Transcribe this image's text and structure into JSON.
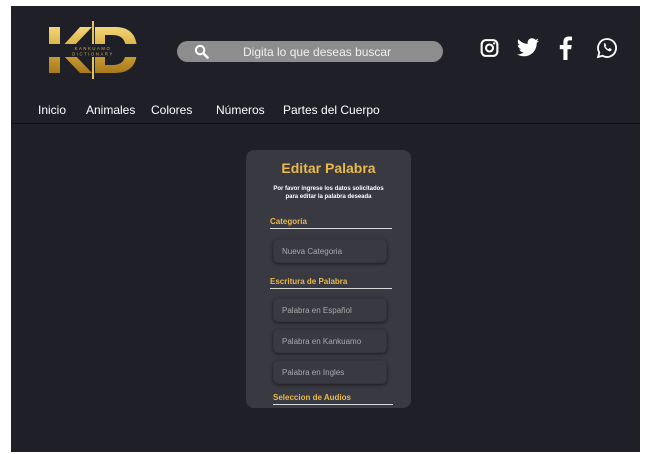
{
  "brand": {
    "logo_letters": "KD",
    "logo_line1": "KANKUAMO",
    "logo_line2": "DICTIONARY"
  },
  "search": {
    "placeholder": "Digita lo que deseas buscar"
  },
  "social": [
    "instagram-icon",
    "twitter-icon",
    "facebook-icon",
    "whatsapp-icon"
  ],
  "nav": {
    "items": [
      "Inicio",
      "Animales",
      "Colores",
      "Números",
      "Partes del Cuerpo"
    ]
  },
  "form": {
    "title": "Editar Palabra",
    "subtitle_line1": "Por favor ingrese los datos solicitados",
    "subtitle_line2": "para editar la palabra deseada",
    "section_category": "Categoria",
    "category_placeholder": "Nueva Categoria",
    "section_word": "Escritura de Palabra",
    "word_es_placeholder": "Palabra en Español",
    "word_kk_placeholder": "Palabra en Kankuamo",
    "word_en_placeholder": "Palabra en Ingles",
    "section_audio": "Seleccion de Audios"
  },
  "colors": {
    "background": "#1f1f27",
    "card": "#393942",
    "accent": "#e9b949",
    "search": "#8d8d8d"
  }
}
